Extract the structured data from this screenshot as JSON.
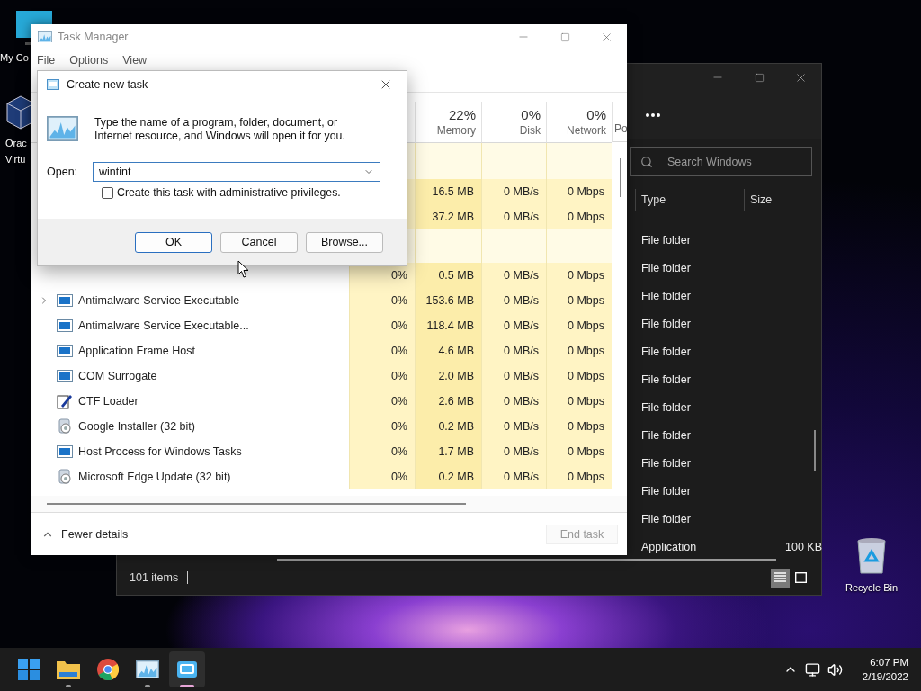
{
  "desktop_icons": [
    {
      "kind": "computer",
      "lines": [
        "My Co"
      ]
    },
    {
      "kind": "virtualbox",
      "lines": [
        "Orac",
        "Virtu"
      ]
    },
    {
      "kind": "recycle_bin",
      "lines": [
        "Recycle Bin"
      ]
    }
  ],
  "explorer": {
    "search": {
      "placeholder": "Search Windows"
    },
    "columns": [
      "Type",
      "Size"
    ],
    "rows": [
      {
        "type": "File folder"
      },
      {
        "type": "File folder"
      },
      {
        "type": "File folder"
      },
      {
        "type": "File folder"
      },
      {
        "type": "File folder"
      },
      {
        "type": "File folder"
      },
      {
        "type": "File folder"
      },
      {
        "type": "File folder"
      },
      {
        "type": "File folder"
      },
      {
        "type": "File folder"
      },
      {
        "type": "File folder"
      },
      {
        "type": "Application",
        "size": "100 KB"
      }
    ],
    "status": "101 items",
    "views": [
      {
        "kind": "details",
        "selected": true
      },
      {
        "kind": "tiles",
        "selected": false
      }
    ]
  },
  "task_manager": {
    "title": "Task Manager",
    "menu": [
      "File",
      "Options",
      "View"
    ],
    "columns": [
      {
        "percent": "22%",
        "label": "Memory"
      },
      {
        "percent": "0%",
        "label": "Disk"
      },
      {
        "percent": "0%",
        "label": "Network"
      },
      {
        "label": "Po"
      }
    ],
    "rows": [
      {
        "kind": "group"
      },
      {
        "kind": "process",
        "memory": "16.5 MB",
        "disk": "0 MB/s",
        "network": "0 Mbps"
      },
      {
        "kind": "process",
        "memory": "37.2 MB",
        "disk": "0 MB/s",
        "network": "0 Mbps"
      },
      {
        "kind": "group"
      },
      {
        "kind": "process",
        "cpu": "0%",
        "memory": "0.5 MB",
        "disk": "0 MB/s",
        "network": "0 Mbps"
      },
      {
        "kind": "process",
        "name": "Antimalware Service Executable",
        "expandable": true,
        "cpu": "0%",
        "memory": "153.6 MB",
        "disk": "0 MB/s",
        "network": "0 Mbps"
      },
      {
        "kind": "process",
        "name": "Antimalware Service Executable...",
        "expandable": false,
        "cpu": "0%",
        "memory": "118.4 MB",
        "disk": "0 MB/s",
        "network": "0 Mbps"
      },
      {
        "kind": "process",
        "name": "Application Frame Host",
        "expandable": false,
        "cpu": "0%",
        "memory": "4.6 MB",
        "disk": "0 MB/s",
        "network": "0 Mbps"
      },
      {
        "kind": "process",
        "name": "COM Surrogate",
        "expandable": false,
        "cpu": "0%",
        "memory": "2.0 MB",
        "disk": "0 MB/s",
        "network": "0 Mbps"
      },
      {
        "kind": "process",
        "name": "CTF Loader",
        "expandable": false,
        "cpu": "0%",
        "memory": "2.6 MB",
        "disk": "0 MB/s",
        "network": "0 Mbps"
      },
      {
        "kind": "process",
        "name": "Google Installer (32 bit)",
        "expandable": false,
        "cpu": "0%",
        "memory": "0.2 MB",
        "disk": "0 MB/s",
        "network": "0 Mbps"
      },
      {
        "kind": "process",
        "name": "Host Process for Windows Tasks",
        "expandable": false,
        "cpu": "0%",
        "memory": "1.7 MB",
        "disk": "0 MB/s",
        "network": "0 Mbps"
      },
      {
        "kind": "process",
        "name": "Microsoft Edge Update (32 bit)",
        "expandable": false,
        "cpu": "0%",
        "memory": "0.2 MB",
        "disk": "0 MB/s",
        "network": "0 Mbps"
      }
    ],
    "details_toggle": "Fewer details",
    "end_task": {
      "label": "End task",
      "disabled": true
    }
  },
  "dialog": {
    "title": "Create new task",
    "message": "Type the name of a program, folder, document, or Internet resource, and Windows will open it for you.",
    "open_label": "Open:",
    "open_value": "wintint",
    "admin_checkbox": {
      "label": "Create this task with administrative privileges.",
      "checked": false
    },
    "buttons": [
      {
        "label": "OK",
        "default": true
      },
      {
        "label": "Cancel",
        "default": false
      },
      {
        "label": "Browse...",
        "default": false
      }
    ]
  },
  "taskbar": {
    "apps": [
      {
        "kind": "start",
        "running": false,
        "active": false
      },
      {
        "kind": "explorer",
        "running": true,
        "active": false
      },
      {
        "kind": "browser",
        "running": false,
        "active": false
      },
      {
        "kind": "task_manager",
        "running": true,
        "active": false
      },
      {
        "kind": "app",
        "running": true,
        "active": true
      }
    ],
    "time": "6:07 PM",
    "date": "2/19/2022"
  }
}
